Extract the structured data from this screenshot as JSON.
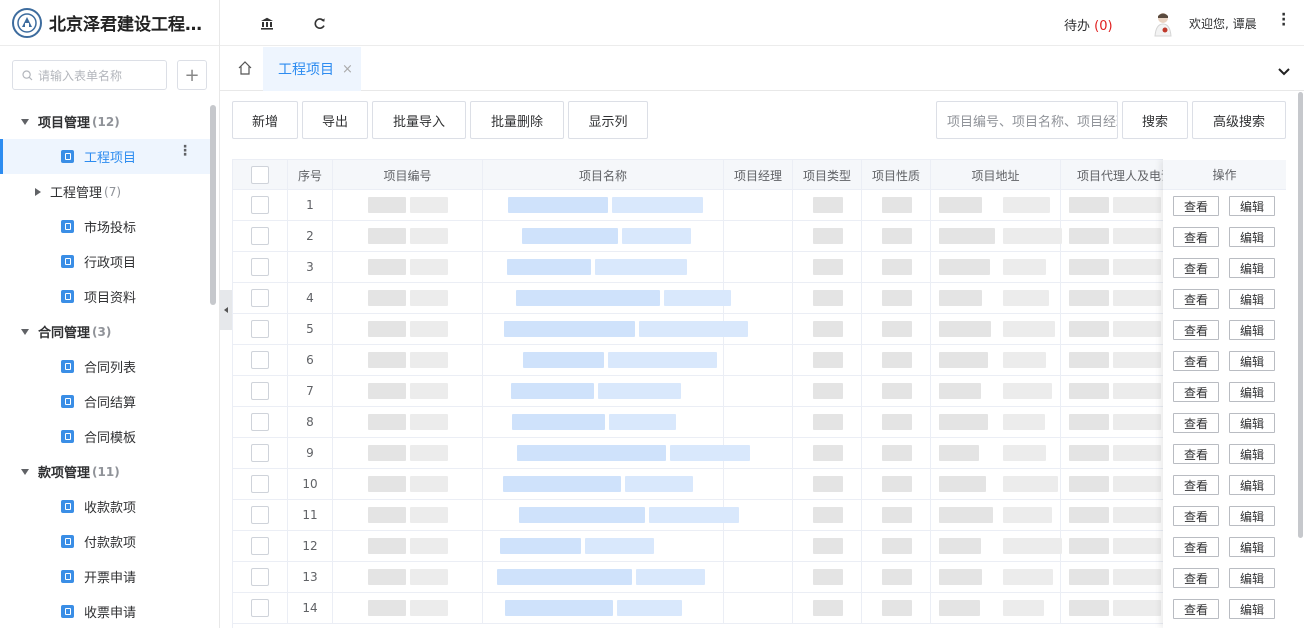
{
  "brand": {
    "name": "北京泽君建设工程有限公司"
  },
  "sidebar": {
    "search_placeholder": "请输入表单名称",
    "add_label": "+",
    "groups": [
      {
        "label": "项目管理",
        "count": "(12)"
      },
      {
        "label": "合同管理",
        "count": "(3)"
      },
      {
        "label": "款项管理",
        "count": "(11)"
      }
    ],
    "sub": {
      "label": "工程管理",
      "count": "(7)"
    },
    "items": [
      "工程项目",
      "市场投标",
      "行政项目",
      "项目资料",
      "合同列表",
      "合同结算",
      "合同模板",
      "收款款项",
      "付款款项",
      "开票申请",
      "收票申请"
    ]
  },
  "header": {
    "todo_label": "待办",
    "todo_count": "(0)",
    "welcome": "欢迎您, 谭晨"
  },
  "tabs": [
    {
      "label": "工程项目",
      "close": "×"
    }
  ],
  "toolbar": {
    "add": "新增",
    "export": "导出",
    "import": "批量导入",
    "batch_delete": "批量删除",
    "columns": "显示列",
    "search_placeholder": "项目编号、项目名称、项目经理",
    "search": "搜索",
    "advanced": "高级搜索"
  },
  "table": {
    "columns": [
      "序号",
      "项目编号",
      "项目名称",
      "项目经理",
      "项目类型",
      "项目性质",
      "项目地址",
      "项目代理人及电话",
      "操作"
    ],
    "row_numbers": [
      "1",
      "2",
      "3",
      "4",
      "5",
      "6",
      "7",
      "8",
      "9",
      "10",
      "11",
      "12",
      "13",
      "14"
    ],
    "view_label": "查看",
    "edit_label": "编辑"
  },
  "colors": {
    "accent": "#2d8cf0",
    "todo_count": "#e02020"
  }
}
